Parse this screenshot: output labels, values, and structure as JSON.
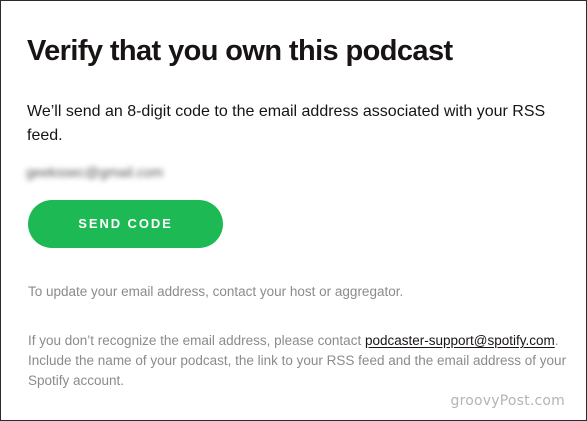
{
  "dialog": {
    "title": "Verify that you own this podcast",
    "description": "We’ll send an 8-digit code to the email address associated with your RSS feed.",
    "email_masked": "geekssec@gmail.com",
    "send_button_label": "SEND CODE",
    "update_note": "To update your email address, contact your host or aggregator.",
    "recognize_note_prefix": "If you don’t recognize the email address, please contact ",
    "support_link_text": "podcaster-support@spotify.com",
    "recognize_note_suffix": ". Include the name of your podcast, the link to your RSS feed and the email address of your Spotify account."
  },
  "watermark": "groovyPost.com",
  "colors": {
    "accent_green": "#1db954",
    "text_dark": "#191414",
    "text_muted": "#8b8b8b"
  }
}
